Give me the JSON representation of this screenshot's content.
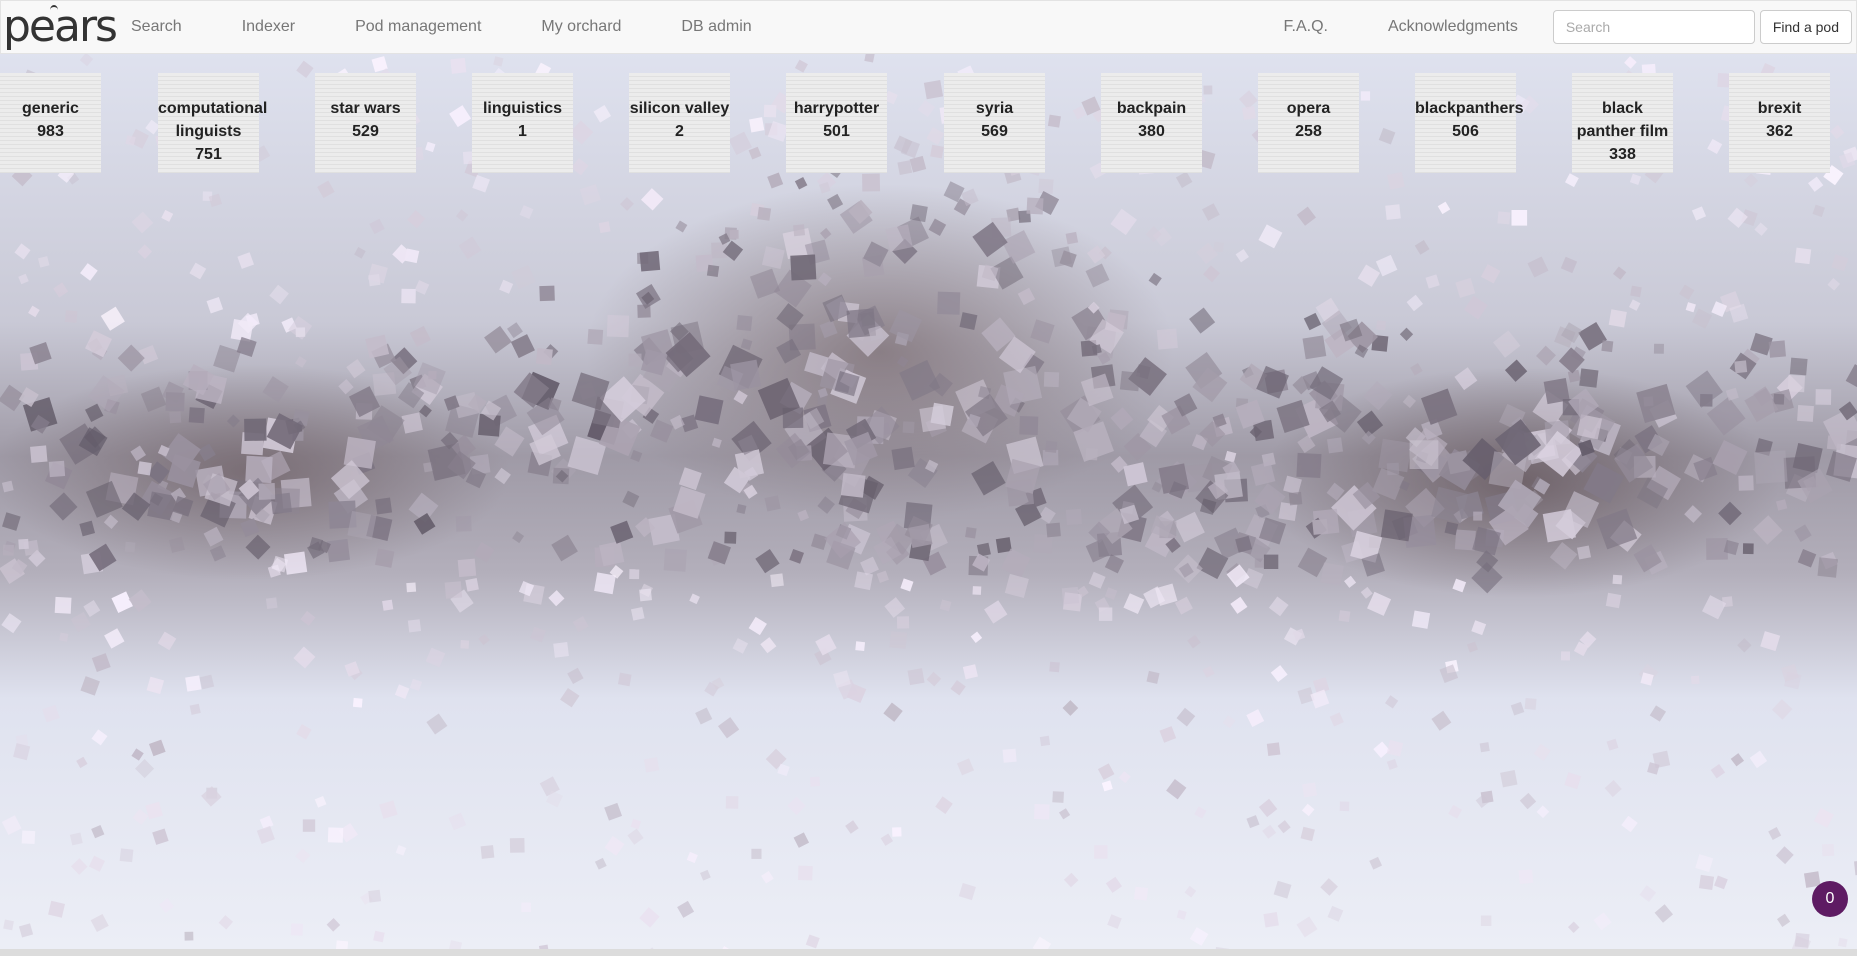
{
  "logo": {
    "text": "pears"
  },
  "nav": {
    "left": [
      "Search",
      "Indexer",
      "Pod management",
      "My orchard",
      "DB admin"
    ],
    "right": [
      "F.A.Q.",
      "Acknowledgments"
    ]
  },
  "search": {
    "placeholder": "Search",
    "value": ""
  },
  "find_button": "Find a pod",
  "pods": [
    {
      "name": "generic",
      "count": "983"
    },
    {
      "name": "computational linguists",
      "count": "751"
    },
    {
      "name": "star wars",
      "count": "529"
    },
    {
      "name": "linguistics",
      "count": "1"
    },
    {
      "name": "silicon valley",
      "count": "2"
    },
    {
      "name": "harrypotter",
      "count": "501"
    },
    {
      "name": "syria",
      "count": "569"
    },
    {
      "name": "backpain",
      "count": "380"
    },
    {
      "name": "opera",
      "count": "258"
    },
    {
      "name": "blackpanthers",
      "count": "506"
    },
    {
      "name": "black panther film",
      "count": "338"
    },
    {
      "name": "brexit",
      "count": "362"
    }
  ],
  "notification_badge": "0",
  "colors": {
    "badge": "#5e1b63",
    "navbar": "#f8f8f8",
    "pod": "#ececec"
  }
}
